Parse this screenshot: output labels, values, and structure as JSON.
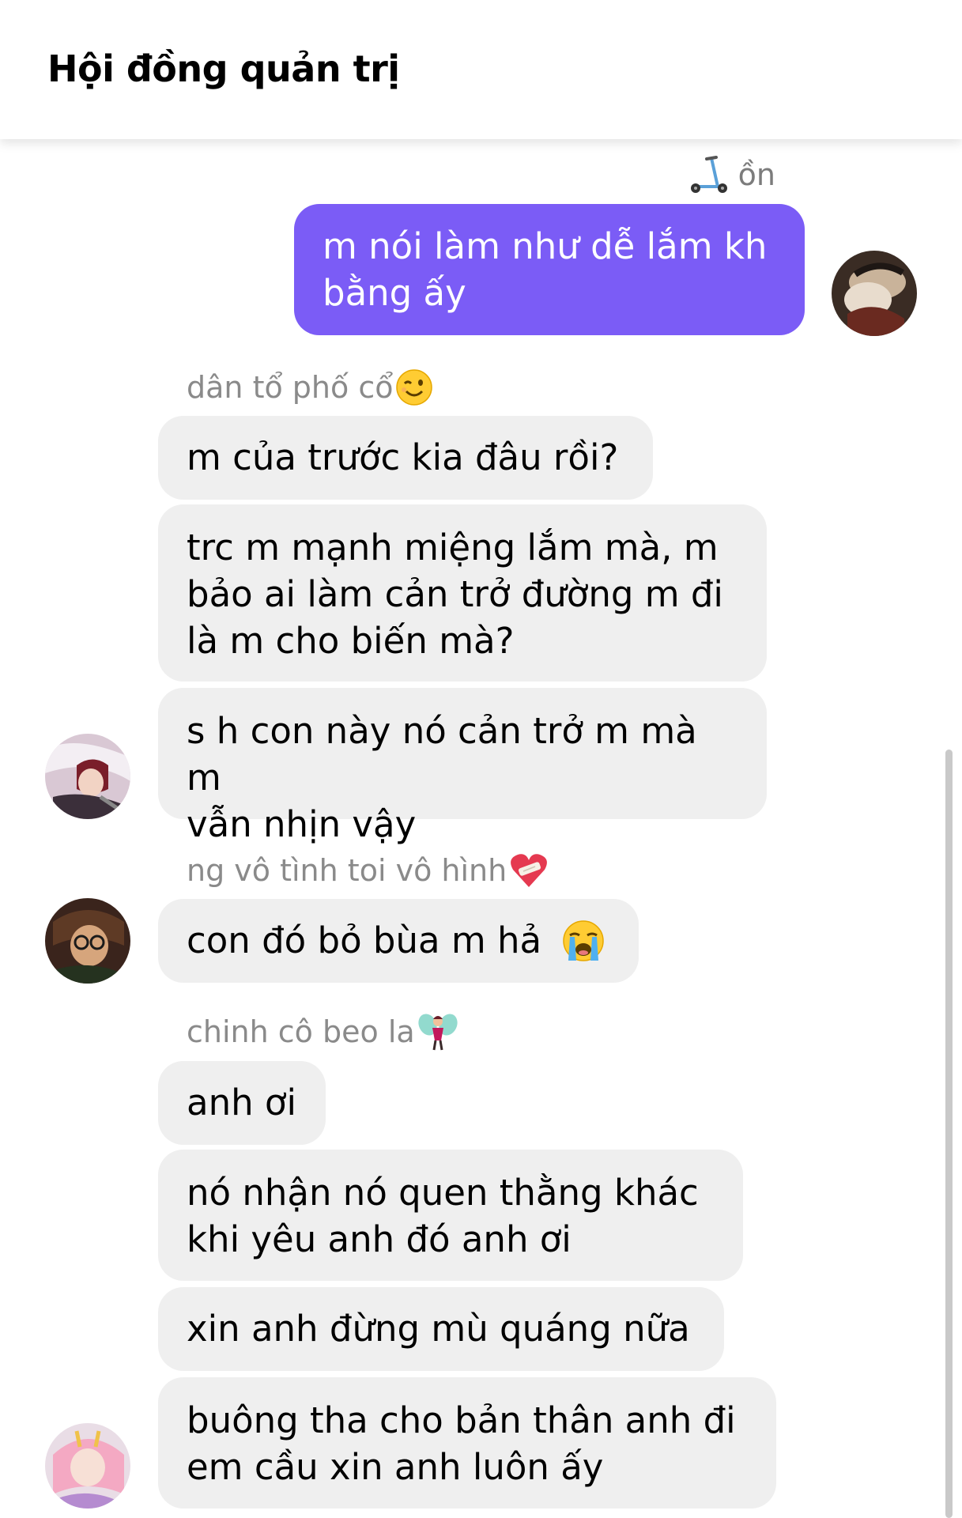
{
  "header": {
    "title": "Hội đồng quản trị"
  },
  "accent_color": "#7b5cf6",
  "messages": {
    "reader_name": "ồn",
    "out_1": {
      "line1": "m nói làm như dễ lắm kh",
      "line2": "bằng ấy"
    },
    "sender_1": "dân tổ phố cổ",
    "in_1": "m của trước kia đâu rồi?",
    "in_2": {
      "line1": "trc m mạnh miệng lắm mà, m",
      "line2": "bảo ai làm cản trở đường m đi",
      "line3": "là m cho biến mà?"
    },
    "in_3": {
      "line1": "s h con này nó cản trở m mà m",
      "line2": "vẫn nhịn vậy"
    },
    "sender_2": "ng vô tình toi vô hình",
    "in_4": "con đó bỏ bùa m hả",
    "sender_3": "chinh cô beo la",
    "in_5": "anh ơi",
    "in_6": {
      "line1": "nó nhận nó quen thằng khác",
      "line2": "khi yêu anh đó anh ơi"
    },
    "in_7": "xin anh đừng mù quáng nữa",
    "in_8": {
      "line1": "buông tha cho bản thân anh đi",
      "line2": "em cầu xin anh luôn ấy"
    }
  },
  "icons": {
    "reader_icon": "kick-scooter-icon",
    "sender_1_emoji": "winking-face-icon",
    "sender_2_emoji": "mending-heart-icon",
    "in_4_emoji": "loudly-crying-face-icon",
    "sender_3_emoji": "fairy-icon"
  }
}
